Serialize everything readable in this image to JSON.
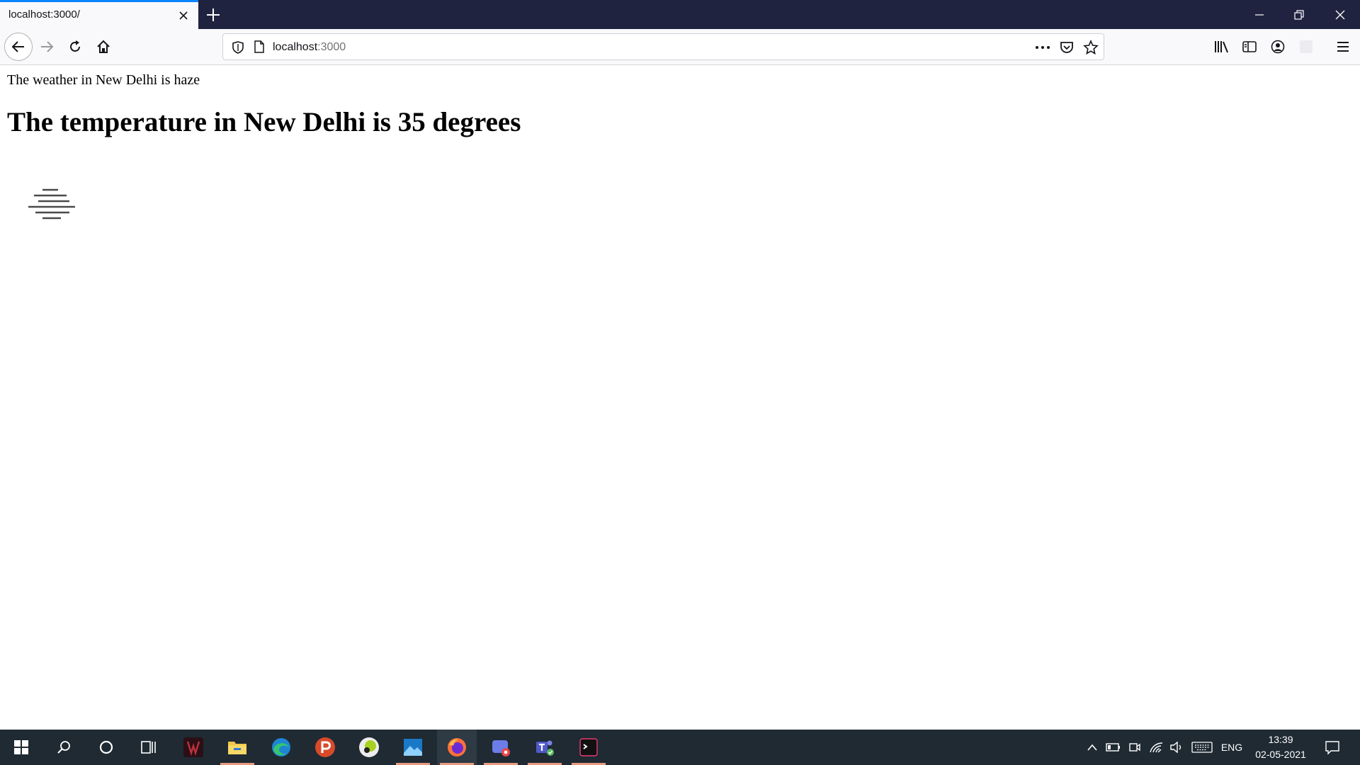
{
  "browser": {
    "tab": {
      "title": "localhost:3000/"
    },
    "url": {
      "host": "localhost",
      "port": ":3000"
    }
  },
  "page": {
    "weather_text": "The weather in New Delhi is haze",
    "temperature_heading": "The temperature in New Delhi is 35 degrees",
    "weather_icon": "haze-icon"
  },
  "taskbar": {
    "apps": [
      "start",
      "search",
      "cortana",
      "task-view",
      "game-app",
      "file-explorer",
      "edge",
      "p-app",
      "lime-app",
      "photos",
      "firefox",
      "capture-app",
      "teams",
      "terminal"
    ],
    "tray": {
      "language": "ENG",
      "time": "13:39",
      "date": "02-05-2021"
    }
  },
  "colors": {
    "tab_strip": "#202340",
    "tab_accent": "#0a84ff",
    "taskbar": "#1f2a33"
  }
}
